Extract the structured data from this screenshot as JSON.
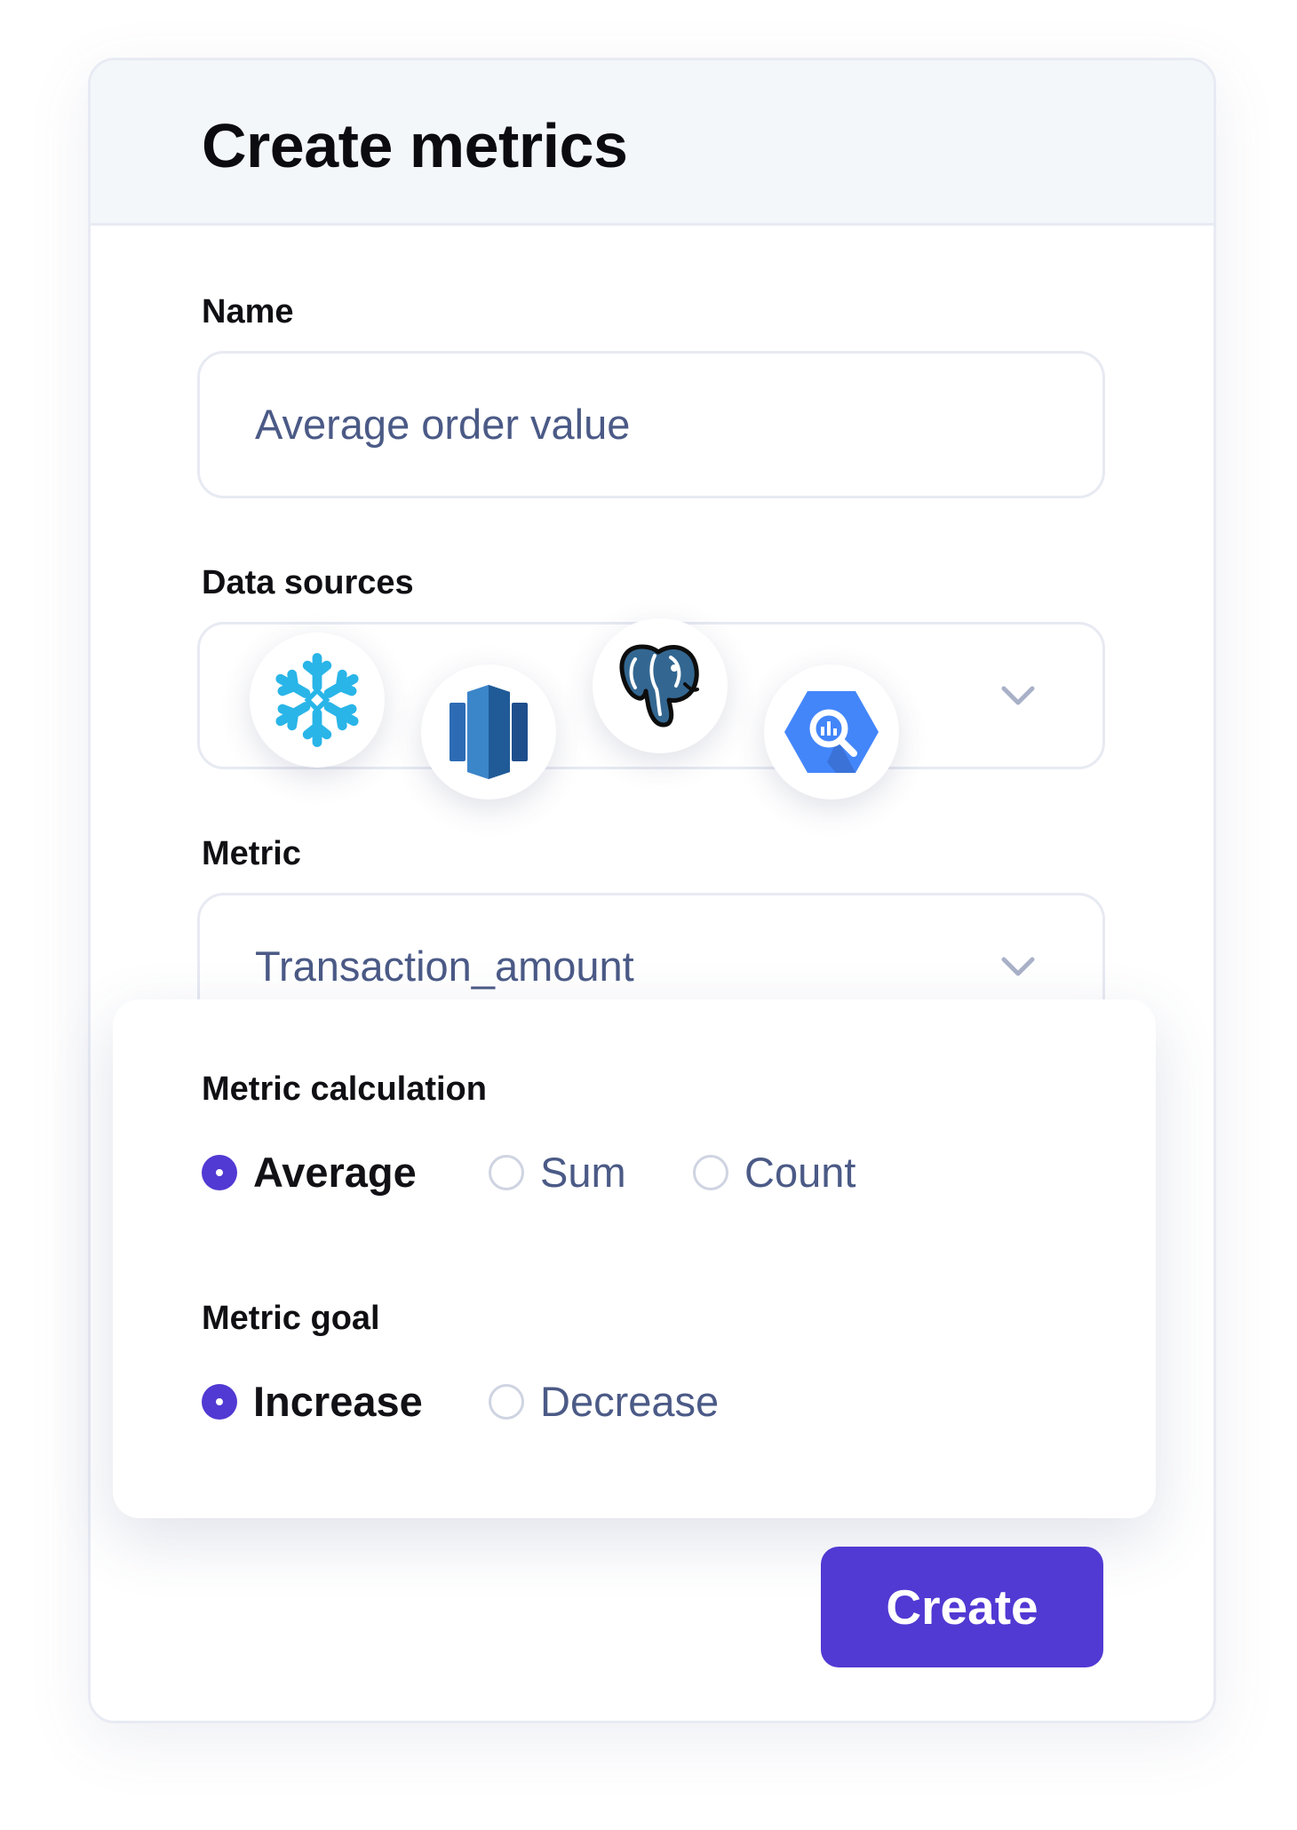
{
  "card": {
    "title": "Create metrics"
  },
  "name_field": {
    "label": "Name",
    "value": "Average order value"
  },
  "data_sources": {
    "label": "Data sources",
    "icons": [
      "snowflake-icon",
      "redshift-icon",
      "postgresql-icon",
      "bigquery-icon"
    ]
  },
  "metric_field": {
    "label": "Metric",
    "value": "Transaction_amount"
  },
  "metric_calculation": {
    "label": "Metric calculation",
    "options": [
      "Average",
      "Sum",
      "Count"
    ],
    "selected": "Average"
  },
  "metric_goal": {
    "label": "Metric goal",
    "options": [
      "Increase",
      "Decrease"
    ],
    "selected": "Increase"
  },
  "actions": {
    "create_label": "Create"
  },
  "colors": {
    "accent": "#5139d3",
    "muted_text": "#4b5a86",
    "header_bg": "#f4f7fa",
    "border": "#e7eaf2",
    "snowflake": "#29b5e8",
    "redshift": "#2d6bb4",
    "postgres": "#336791",
    "bigquery": "#4386fa"
  }
}
